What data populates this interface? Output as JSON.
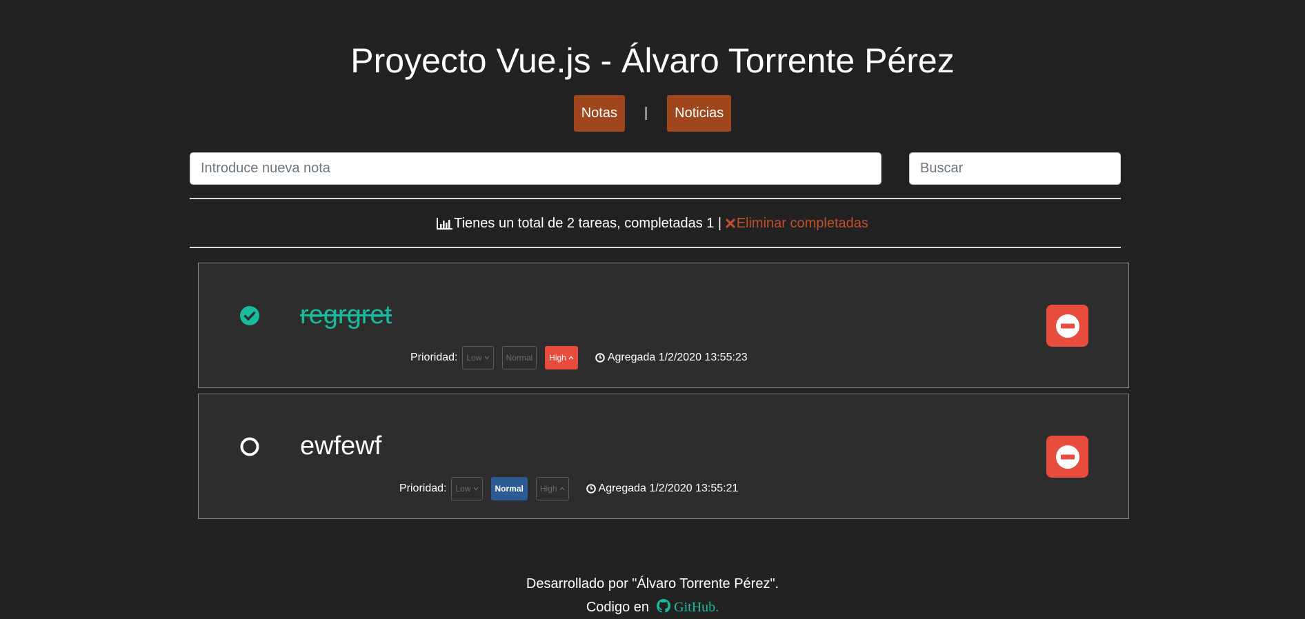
{
  "header": {
    "title": "Proyecto Vue.js - Álvaro Torrente Pérez"
  },
  "nav": {
    "notas": "Notas",
    "separator": "|",
    "noticias": "Noticias"
  },
  "new_note": {
    "placeholder": "Introduce nueva nota",
    "value": ""
  },
  "search": {
    "placeholder": "Buscar",
    "value": ""
  },
  "summary": {
    "icon": "bar-chart-icon",
    "text": "Tienes un total de 2 tareas, completadas 1 | ",
    "delete_icon": "times-icon",
    "delete_label": "Eliminar completadas"
  },
  "notes": [
    {
      "text": "regrgret",
      "completed": true,
      "priority_label": "Prioridad:",
      "priority": {
        "low": "Low",
        "normal": "Normal",
        "high": "High",
        "selected": "High"
      },
      "added": "Agregada 1/2/2020 13:55:23"
    },
    {
      "text": "ewfewf",
      "completed": false,
      "priority_label": "Prioridad:",
      "priority": {
        "low": "Low",
        "normal": "Normal",
        "high": "High",
        "selected": "Normal"
      },
      "added": "Agregada 1/2/2020 13:55:21"
    }
  ],
  "footer": {
    "line1": "Desarrollado por \"Álvaro Torrente Pérez\".",
    "line2_prefix": "Codigo en ",
    "github_label": "GitHub.",
    "github_icon": "github-icon"
  },
  "colors": {
    "background": "#222222",
    "card": "#2d2d2d",
    "brand": "#a0461d",
    "success": "#18bc9c",
    "danger": "#e74c3c",
    "primary": "#2c5b93"
  }
}
